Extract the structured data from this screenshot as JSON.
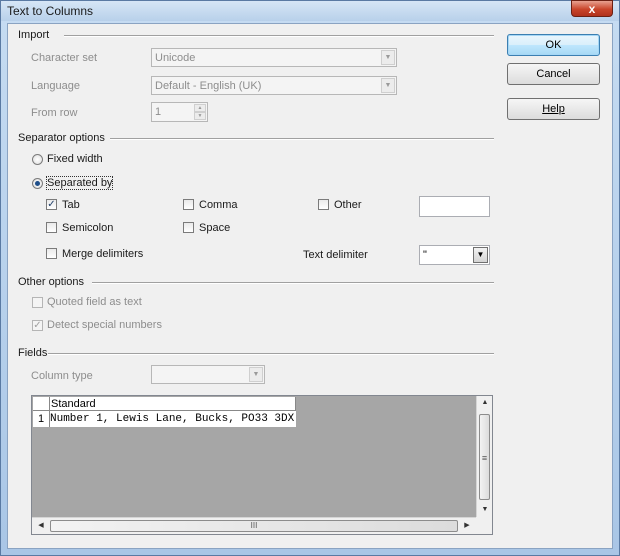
{
  "window": {
    "title": "Text to Columns",
    "close_glyph": "x"
  },
  "import": {
    "section_label": "Import",
    "character_set": {
      "label": "Character set",
      "value": "Unicode"
    },
    "language": {
      "label": "Language",
      "value": "Default - English (UK)"
    },
    "from_row": {
      "label": "From row",
      "value": "1"
    }
  },
  "buttons": {
    "ok": "OK",
    "cancel": "Cancel",
    "help": "Help"
  },
  "separator_options": {
    "section_label": "Separator options",
    "fixed_width": {
      "label": "Fixed width",
      "selected": false
    },
    "separated_by": {
      "label": "Separated by",
      "selected": true
    },
    "tab": {
      "label": "Tab",
      "checked": true
    },
    "comma": {
      "label": "Comma",
      "checked": false
    },
    "other": {
      "label": "Other",
      "checked": false,
      "value": ""
    },
    "semicolon": {
      "label": "Semicolon",
      "checked": false
    },
    "space": {
      "label": "Space",
      "checked": false
    },
    "merge_delimiters": {
      "label": "Merge delimiters",
      "checked": false
    },
    "text_delimiter": {
      "label": "Text delimiter",
      "value": "\""
    }
  },
  "other_options": {
    "section_label": "Other options",
    "quoted_field": {
      "label": "Quoted field as text",
      "checked": false
    },
    "detect_special": {
      "label": "Detect special numbers",
      "checked": true
    }
  },
  "fields": {
    "section_label": "Fields",
    "column_type": {
      "label": "Column type",
      "value": ""
    },
    "preview": {
      "column_header": "Standard",
      "row_number": "1",
      "row_text": "Number 1, Lewis Lane, Bucks, PO33 3DX",
      "hscroll_grip": "III"
    }
  },
  "icons": {
    "checkmark": "✓",
    "combo_arrow": "▼",
    "spin_up": "▲",
    "spin_down": "▼",
    "scroll_up": "▲",
    "scroll_down": "▼",
    "scroll_left": "◀",
    "scroll_right": "▶",
    "vscroll_grip": "≡"
  }
}
